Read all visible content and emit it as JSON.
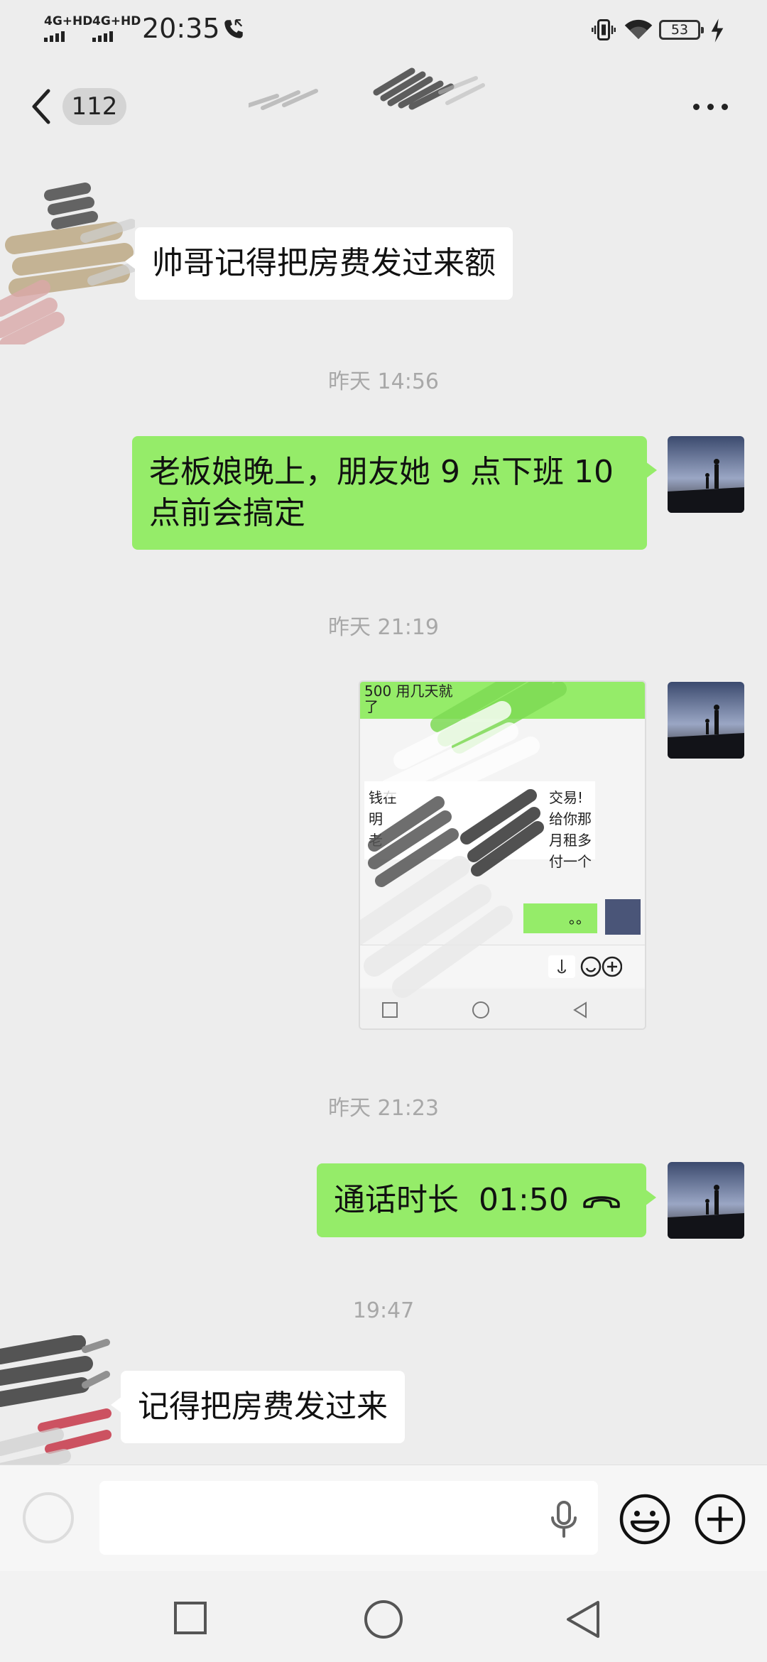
{
  "status_bar": {
    "sim1_label": "4G+HD",
    "sim2_label": "4G+HD",
    "time": "20:35",
    "battery_level": "53",
    "icons": [
      "phone-call-icon",
      "vibrate-icon",
      "wifi-icon",
      "battery-icon",
      "charging-icon"
    ]
  },
  "header": {
    "unread_count": "112",
    "back_icon": "chevron-left-icon",
    "more_icon": "more-dots-icon"
  },
  "messages": [
    {
      "side": "left",
      "text": "帅哥记得把房费发过来额"
    },
    {
      "type": "time",
      "text": "昨天 14:56"
    },
    {
      "side": "right",
      "text": "老板娘晚上，朋友她 9 点下班 10 点前会搞定"
    },
    {
      "type": "time",
      "text": "昨天 21:19"
    },
    {
      "side": "right",
      "type": "image",
      "inner_green_text": "500 用几天就",
      "inner_green_text2": "了",
      "inner_white_lines": [
        "钱在",
        "明",
        "老"
      ],
      "inner_white_right": [
        "交易!",
        "给你那",
        "月租多",
        "付一个"
      ],
      "inner_small_green": "。。"
    },
    {
      "type": "time",
      "text": "昨天 21:23"
    },
    {
      "side": "right",
      "type": "call",
      "text": "通话时长  01:50"
    },
    {
      "type": "time",
      "text": "19:47"
    },
    {
      "side": "left",
      "text": "记得把房费发过来"
    }
  ],
  "input_bar": {
    "icons": [
      "voice-icon",
      "mic-icon",
      "emoji-icon",
      "plus-icon"
    ]
  },
  "nav_bar": {
    "icons": [
      "recent-apps-icon",
      "home-icon",
      "back-triangle-icon"
    ]
  },
  "colors": {
    "background": "#ededed",
    "bubble_green": "#95ec69",
    "bubble_white": "#ffffff",
    "time_gray": "#a8a8a8"
  }
}
